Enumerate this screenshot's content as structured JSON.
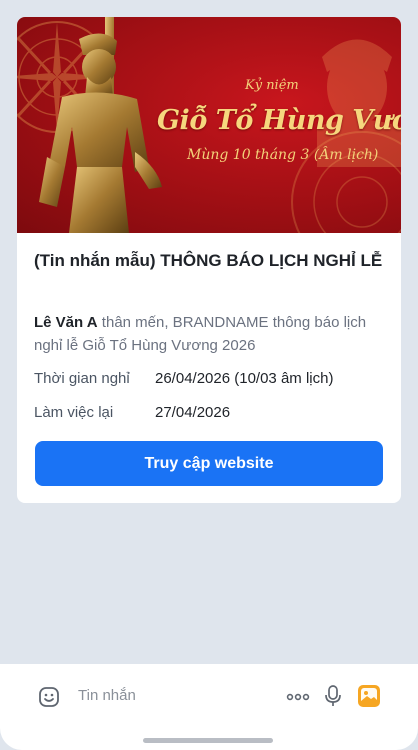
{
  "banner": {
    "subtitle": "Kỷ niệm",
    "title": "Giỗ Tổ Hùng Vương",
    "date": "Mùng 10 tháng 3 (Âm lịch)"
  },
  "message": {
    "title": "(Tin nhắn mẫu) THÔNG BÁO LỊCH NGHỈ LỄ",
    "recipient": "Lê Văn A",
    "body": " thân mến, BRANDNAME thông báo lịch nghỉ lễ Giỗ Tổ Hùng Vương 2026",
    "details": [
      {
        "label": "Thời gian nghỉ",
        "value": "26/04/2026 (10/03 âm lịch)"
      },
      {
        "label": "Làm việc lại",
        "value": "27/04/2026"
      }
    ],
    "button_label": "Truy cập website"
  },
  "input_bar": {
    "placeholder": "Tin nhắn",
    "icons": [
      "emoji-icon",
      "more-icon",
      "microphone-icon",
      "image-icon"
    ]
  },
  "colors": {
    "background": "#dfe5ed",
    "banner_red": "#c8161d",
    "gold": "#f6d77e",
    "button_blue": "#1a73f5"
  }
}
